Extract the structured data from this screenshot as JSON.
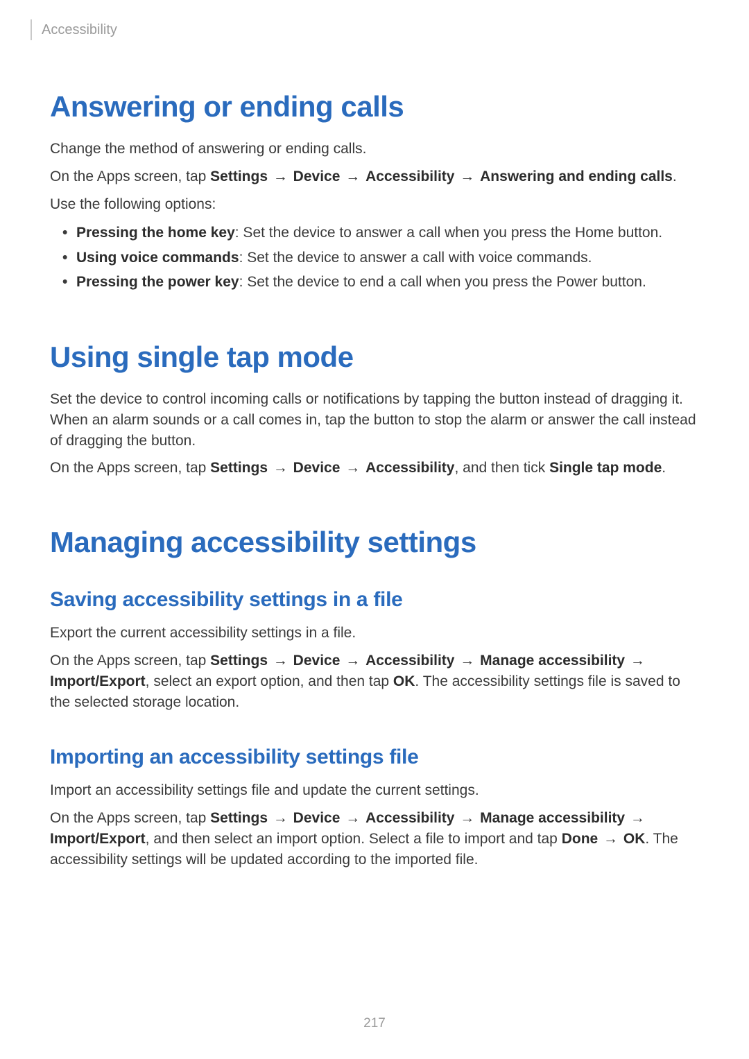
{
  "header": {
    "section_label": "Accessibility"
  },
  "page_number": "217",
  "sections": [
    {
      "heading": "Answering or ending calls",
      "intro": "Change the method of answering or ending calls.",
      "nav_prefix": "On the Apps screen, tap ",
      "nav_steps": [
        "Settings",
        "Device",
        "Accessibility",
        "Answering and ending calls"
      ],
      "nav_suffix": ".",
      "options_lead": "Use the following options:",
      "bullets": [
        {
          "term": "Pressing the home key",
          "desc": ": Set the device to answer a call when you press the Home button."
        },
        {
          "term": "Using voice commands",
          "desc": ": Set the device to answer a call with voice commands."
        },
        {
          "term": "Pressing the power key",
          "desc": ": Set the device to end a call when you press the Power button."
        }
      ]
    },
    {
      "heading": "Using single tap mode",
      "intro": "Set the device to control incoming calls or notifications by tapping the button instead of dragging it. When an alarm sounds or a call comes in, tap the button to stop the alarm or answer the call instead of dragging the button.",
      "nav_prefix": "On the Apps screen, tap ",
      "nav_steps": [
        "Settings",
        "Device",
        "Accessibility"
      ],
      "tail_before": ", and then tick ",
      "tail_bold": "Single tap mode",
      "tail_after": "."
    },
    {
      "heading": "Managing accessibility settings",
      "subsections": [
        {
          "heading": "Saving accessibility settings in a file",
          "intro": "Export the current accessibility settings in a file.",
          "nav_prefix": "On the Apps screen, tap ",
          "nav_steps": [
            "Settings",
            "Device",
            "Accessibility",
            "Manage accessibility",
            "Import/Export"
          ],
          "mid1": ", select an export option, and then tap ",
          "mid1_bold": "OK",
          "mid1_after": ". The accessibility settings file is saved to the selected storage location."
        },
        {
          "heading": "Importing an accessibility settings file",
          "intro": "Import an accessibility settings file and update the current settings.",
          "nav_prefix": "On the Apps screen, tap ",
          "nav_steps": [
            "Settings",
            "Device",
            "Accessibility",
            "Manage accessibility",
            "Import/Export"
          ],
          "mid1": ", and then select an import option. Select a file to import and tap ",
          "done_bold": "Done",
          "arrow": " → ",
          "ok_bold": "OK",
          "tail": ". The accessibility settings will be updated according to the imported file."
        }
      ]
    }
  ],
  "arrow_glyph": " → "
}
